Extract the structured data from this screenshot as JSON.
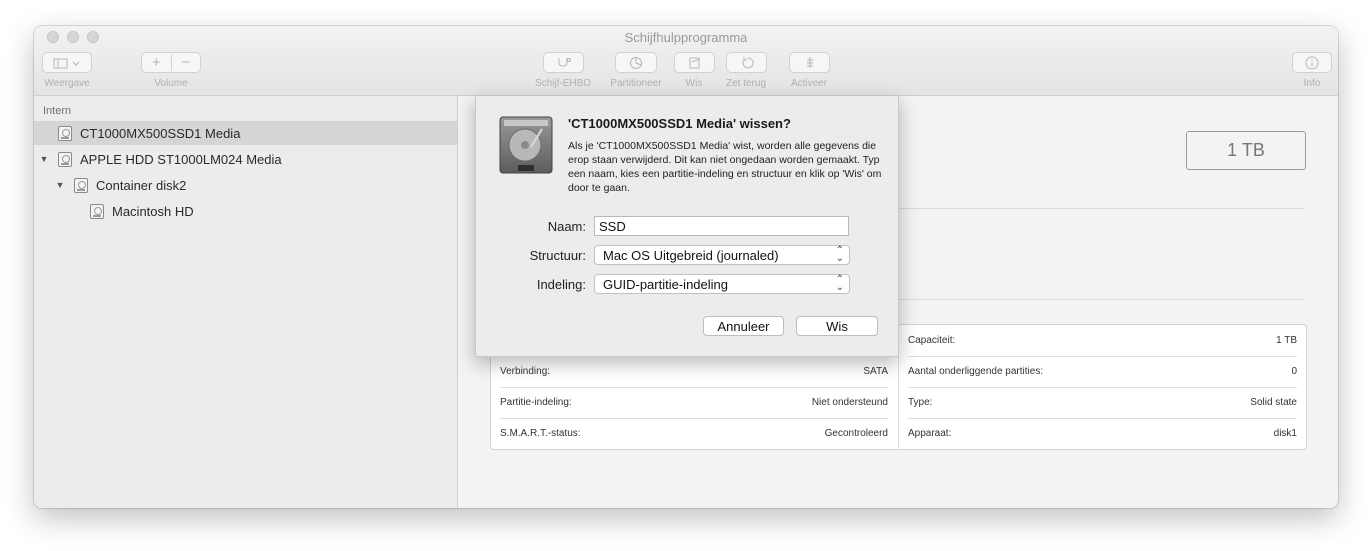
{
  "window": {
    "title": "Schijfhulpprogramma"
  },
  "toolbar": {
    "view_label": "Weergave",
    "volume_label": "Volume",
    "firstaid_label": "Schijf-EHBO",
    "partition_label": "Partitioneer",
    "erase_label": "Wis",
    "restore_label": "Zet terug",
    "mount_label": "Activeer",
    "info_label": "Info"
  },
  "sidebar": {
    "section": "Intern",
    "items": [
      {
        "label": "CT1000MX500SSD1 Media"
      },
      {
        "label": "APPLE HDD ST1000LM024 Media"
      },
      {
        "label": "Container disk2"
      },
      {
        "label": "Macintosh HD"
      }
    ]
  },
  "main": {
    "capacity_badge": "1 TB",
    "info": {
      "left": [
        {
          "key": "Verbinding:",
          "value": "SATA"
        },
        {
          "key": "Partitie-indeling:",
          "value": "Niet ondersteund"
        },
        {
          "key": "S.M.A.R.T.-status:",
          "value": "Gecontroleerd"
        }
      ],
      "right": [
        {
          "key": "Capaciteit:",
          "value": "1 TB"
        },
        {
          "key": "Aantal onderliggende partities:",
          "value": "0"
        },
        {
          "key": "Type:",
          "value": "Solid state"
        },
        {
          "key": "Apparaat:",
          "value": "disk1"
        }
      ]
    }
  },
  "dialog": {
    "title": "'CT1000MX500SSD1 Media' wissen?",
    "message": "Als je 'CT1000MX500SSD1 Media' wist, worden alle gegevens die erop staan verwijderd. Dit kan niet ongedaan worden gemaakt. Typ een naam, kies een partitie-indeling en structuur en klik op 'Wis' om door te gaan.",
    "name_label": "Naam:",
    "name_value": "SSD",
    "format_label": "Structuur:",
    "format_value": "Mac OS Uitgebreid (journaled)",
    "scheme_label": "Indeling:",
    "scheme_value": "GUID-partitie-indeling",
    "cancel_label": "Annuleer",
    "erase_label": "Wis"
  }
}
